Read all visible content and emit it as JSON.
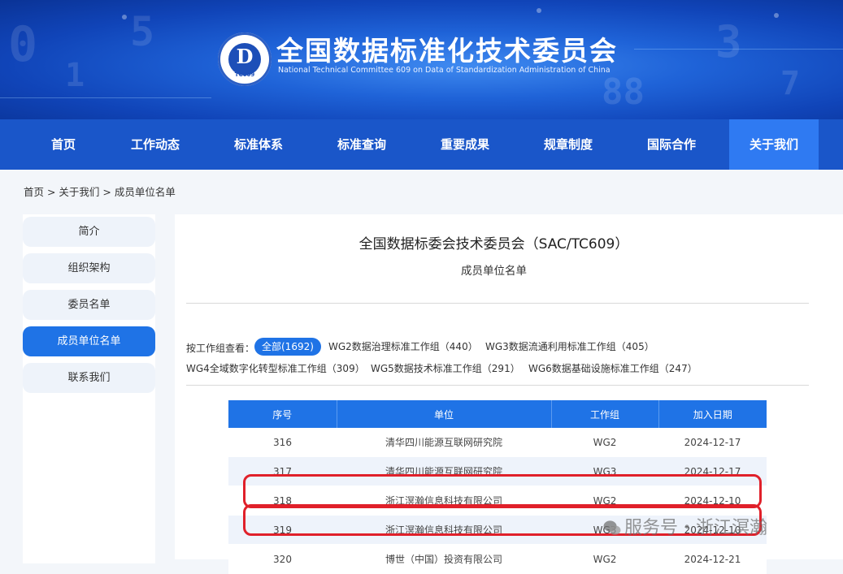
{
  "header": {
    "title": "全国数据标准化技术委员会",
    "subtitle": "National Technical Committee 609 on Data of Standardization Administration of China",
    "logo_text": "TC609"
  },
  "nav": {
    "items": [
      {
        "label": "首页"
      },
      {
        "label": "工作动态"
      },
      {
        "label": "标准体系"
      },
      {
        "label": "标准查询"
      },
      {
        "label": "重要成果"
      },
      {
        "label": "规章制度"
      },
      {
        "label": "国际合作"
      },
      {
        "label": "关于我们",
        "active": true
      }
    ]
  },
  "breadcrumb": "首页 > 关于我们 > 成员单位名单",
  "sidebar": {
    "items": [
      {
        "label": "简介"
      },
      {
        "label": "组织架构"
      },
      {
        "label": "委员名单"
      },
      {
        "label": "成员单位名单",
        "active": true
      },
      {
        "label": "联系我们"
      }
    ]
  },
  "main": {
    "title": "全国数据标委会技术委员会（SAC/TC609）",
    "subtitle": "成员单位名单",
    "filter_label": "按工作组查看：",
    "filters": [
      {
        "label": "全部(1692)",
        "active": true
      },
      {
        "label": "WG2数据治理标准工作组（440）"
      },
      {
        "label": "WG3数据流通利用标准工作组（405）"
      },
      {
        "label": "WG4全域数字化转型标准工作组（309）"
      },
      {
        "label": "WG5数据技术标准工作组（291）"
      },
      {
        "label": "WG6数据基础设施标准工作组（247）"
      }
    ]
  },
  "table": {
    "headers": [
      "序号",
      "单位",
      "工作组",
      "加入日期"
    ],
    "rows": [
      [
        "316",
        "清华四川能源互联网研究院",
        "WG2",
        "2024-12-17"
      ],
      [
        "317",
        "清华四川能源互联网研究院",
        "WG3",
        "2024-12-17"
      ],
      [
        "318",
        "浙江溟瀚信息科技有限公司",
        "WG2",
        "2024-12-10"
      ],
      [
        "319",
        "浙江溟瀚信息科技有限公司",
        "WG3",
        "2024-12-10"
      ],
      [
        "320",
        "博世（中国）投资有限公司",
        "WG2",
        "2024-12-21"
      ]
    ]
  },
  "watermark": "服务号・浙江溟瀚",
  "colors": {
    "primary": "#1f73e6",
    "nav": "#1a56c9",
    "highlight": "#e0202a"
  }
}
